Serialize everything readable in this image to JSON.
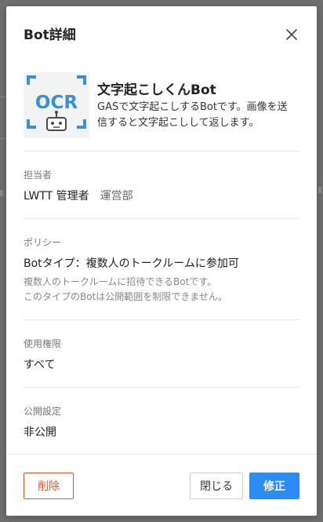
{
  "modal": {
    "title": "Bot詳細"
  },
  "bot": {
    "name": "文字起こしくんBot",
    "description": "GASで文字起こしするBotです。画像を送信すると文字起こしして返します。",
    "logo_text": "OCR"
  },
  "sections": {
    "manager": {
      "label": "担当者",
      "name": "LWTT 管理者",
      "department": "運営部"
    },
    "policy": {
      "label": "ポリシー",
      "value": "Botタイプ：複数人のトークルームに参加可",
      "note_line1": "複数人のトークルームに招待できるBotです。",
      "note_line2": "このタイプのBotは公開範囲を制限できません。"
    },
    "permission": {
      "label": "使用権限",
      "value": "すべて"
    },
    "visibility": {
      "label": "公開設定",
      "value": "非公開"
    }
  },
  "buttons": {
    "delete": "削除",
    "close": "閉じる",
    "edit": "修正"
  },
  "colors": {
    "primary": "#2b8cf3",
    "danger": "#e0583a",
    "logo_blue": "#3b8fd6"
  },
  "icons": {
    "close": "close-icon",
    "logo": "ocr-robot-logo"
  }
}
